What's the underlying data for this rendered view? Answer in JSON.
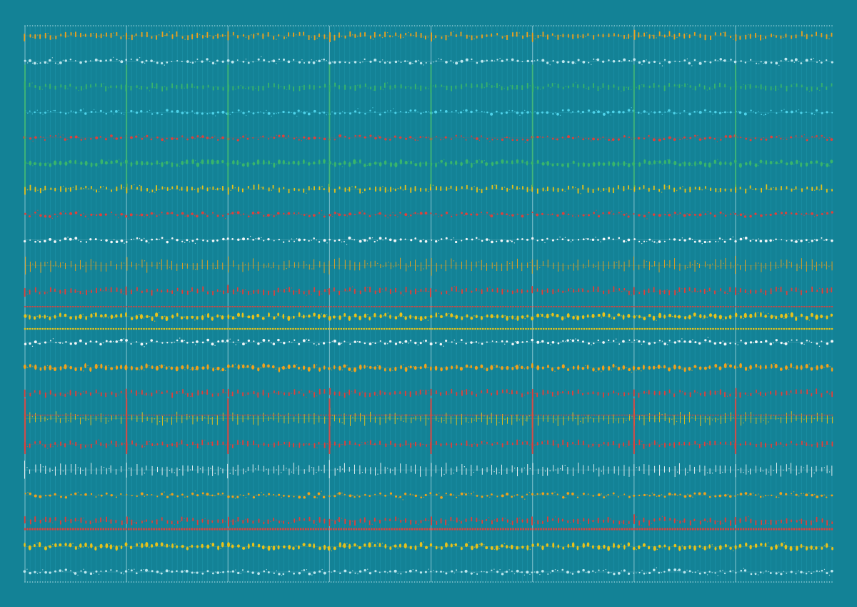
{
  "artwork": {
    "kind": "generative-pattern",
    "description_colors": {
      "background": "#138296",
      "frame": "#2aa9c2",
      "orange": "#f0a21c",
      "yellow": "#e8c21a",
      "red": "#e2403a",
      "green": "#38b56c",
      "cyan": "#4fd3ea",
      "white": "#f4f7f8",
      "light": "#bfe7ee"
    },
    "columns": 160,
    "major_column_every": 20,
    "bands": [
      {
        "color": "orange",
        "style": "dash"
      },
      {
        "color": "light",
        "style": "dot"
      },
      {
        "color": "green",
        "style": "dash"
      },
      {
        "color": "cyan",
        "style": "dot"
      },
      {
        "color": "red",
        "style": "dot"
      },
      {
        "color": "green",
        "style": "bead"
      },
      {
        "color": "yellow",
        "style": "dash"
      },
      {
        "color": "red",
        "style": "dot"
      },
      {
        "color": "white",
        "style": "dot"
      },
      {
        "color": "orange",
        "style": "tick"
      },
      {
        "color": "red",
        "style": "dash"
      },
      {
        "color": "yellow",
        "style": "bead"
      },
      {
        "color": "white",
        "style": "dot"
      },
      {
        "color": "orange",
        "style": "bead"
      },
      {
        "color": "red",
        "style": "dash"
      },
      {
        "color": "yellow",
        "style": "tick"
      },
      {
        "color": "red",
        "style": "dash"
      },
      {
        "color": "white",
        "style": "tick"
      },
      {
        "color": "orange",
        "style": "dot"
      },
      {
        "color": "red",
        "style": "dash"
      },
      {
        "color": "yellow",
        "style": "bead"
      },
      {
        "color": "light",
        "style": "dot"
      }
    ]
  }
}
